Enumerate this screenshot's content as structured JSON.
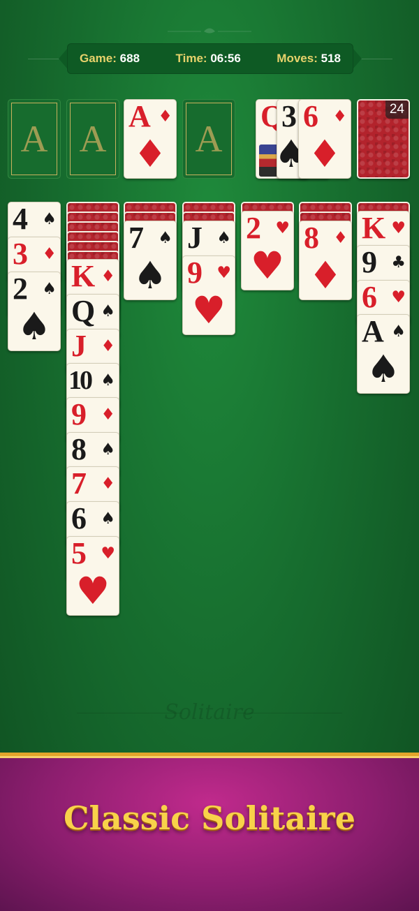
{
  "stats": {
    "game_label": "Game:",
    "game_value": "688",
    "time_label": "Time:",
    "time_value": "06:56",
    "moves_label": "Moves:",
    "moves_value": "518"
  },
  "foundations": {
    "slot_1": "A",
    "slot_2": "A",
    "card_3": {
      "rank": "A",
      "suit": "♦",
      "color": "red"
    },
    "slot_4": "A"
  },
  "waste": [
    {
      "rank": "Q",
      "suit": "♥"
    },
    {
      "rank": "3",
      "suit": "♠"
    },
    {
      "rank": "6",
      "suit": "♦"
    }
  ],
  "stock": {
    "count": "24"
  },
  "tableau": {
    "col1": [
      {
        "rank": "4",
        "suit": "♠"
      },
      {
        "rank": "3",
        "suit": "♦"
      },
      {
        "rank": "2",
        "suit": "♠"
      }
    ],
    "col2": [
      {
        "rank": "K",
        "suit": "♦"
      },
      {
        "rank": "Q",
        "suit": "♠"
      },
      {
        "rank": "J",
        "suit": "♦"
      },
      {
        "rank": "10",
        "suit": "♠"
      },
      {
        "rank": "9",
        "suit": "♦"
      },
      {
        "rank": "8",
        "suit": "♠"
      },
      {
        "rank": "7",
        "suit": "♦"
      },
      {
        "rank": "6",
        "suit": "♠"
      },
      {
        "rank": "5",
        "suit": "♥"
      }
    ],
    "col3": [
      {
        "rank": "7",
        "suit": "♠"
      }
    ],
    "col4": [
      {
        "rank": "J",
        "suit": "♠"
      },
      {
        "rank": "9",
        "suit": "♥"
      }
    ],
    "col5": [
      {
        "rank": "2",
        "suit": "♥"
      }
    ],
    "col6": [
      {
        "rank": "8",
        "suit": "♦"
      }
    ],
    "col7": [
      {
        "rank": "K",
        "suit": "♥"
      },
      {
        "rank": "9",
        "suit": "♣"
      },
      {
        "rank": "6",
        "suit": "♥"
      },
      {
        "rank": "A",
        "suit": "♠"
      }
    ]
  },
  "watermark": "Solitaire",
  "banner": {
    "title": "Classic Solitaire"
  },
  "colors": {
    "felt": "#176e2f",
    "card_red": "#d81f2a",
    "card_black": "#1a1a1a",
    "banner": "#8d1e6f",
    "gold": "#f8d24a"
  }
}
